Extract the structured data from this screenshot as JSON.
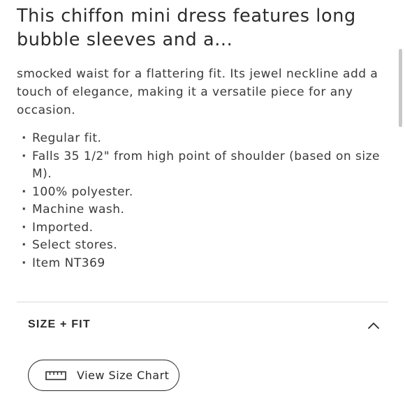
{
  "product": {
    "headline": "This chiffon mini dress features long bubble sleeves and a...",
    "description": "smocked waist for a flattering fit. Its jewel neckline add a touch of elegance, making it a versatile piece for any occasion.",
    "features": [
      "Regular fit.",
      "Falls 35 1/2\" from high point of shoulder (based on size M).",
      "100% polyester.",
      "Machine wash.",
      "Imported.",
      "Select stores.",
      "Item NT369"
    ]
  },
  "size_fit": {
    "title": "SIZE + FIT",
    "expanded": true,
    "toggle_icon": "chevron-up-icon",
    "size_chart_button": {
      "label": "View Size Chart",
      "icon": "ruler-icon"
    }
  },
  "colors": {
    "text": "#2a2a2a",
    "divider": "#d9d9d9",
    "scrollbar": "#c8c8c8",
    "background": "#ffffff"
  }
}
